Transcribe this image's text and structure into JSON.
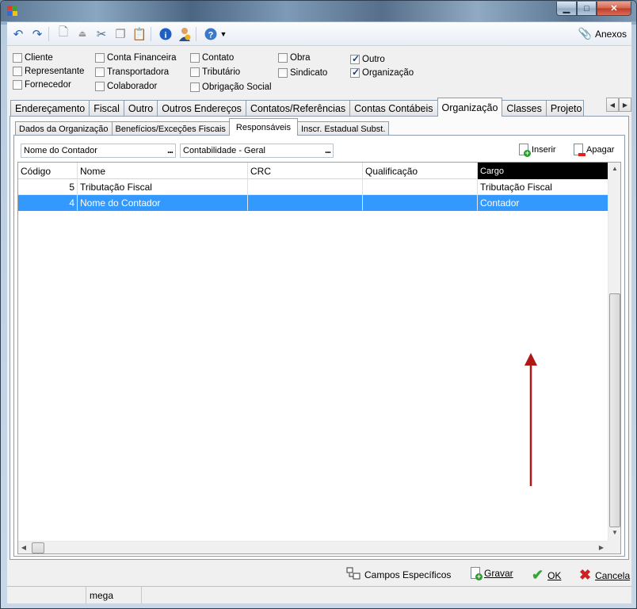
{
  "toolbar": {
    "icons": [
      "undo-icon",
      "redo-icon",
      "new-document-icon",
      "eject-icon",
      "cut-icon",
      "copy-icon",
      "paste-icon",
      "info-icon",
      "user-icon",
      "help-icon",
      "dropdown-arrow-icon"
    ],
    "anexos_label": "Anexos"
  },
  "checkboxes": [
    {
      "label": "Cliente",
      "checked": false
    },
    {
      "label": "Representante",
      "checked": false
    },
    {
      "label": "Fornecedor",
      "checked": false
    },
    {
      "label": "Conta Financeira",
      "checked": false
    },
    {
      "label": "Transportadora",
      "checked": false
    },
    {
      "label": "Colaborador",
      "checked": false
    },
    {
      "label": "Contato",
      "checked": false
    },
    {
      "label": "Tributário",
      "checked": false
    },
    {
      "label": "Obrigação Social",
      "checked": false
    },
    {
      "label": "Obra",
      "checked": false
    },
    {
      "label": "Sindicato",
      "checked": false
    },
    {
      "label": "Outro",
      "checked": true
    },
    {
      "label": "Organização",
      "checked": true
    }
  ],
  "main_tabs": [
    "Endereçamento",
    "Fiscal",
    "Outro",
    "Outros Endereços",
    "Contatos/Referências",
    "Contas Contábeis",
    "Organização",
    "Classes",
    "Projeto"
  ],
  "main_tab_active": "Organização",
  "sub_tabs": [
    "Dados da Organização",
    "Benefícios/Exceções Fiscais",
    "Responsáveis",
    "Inscr. Estadual Subst."
  ],
  "sub_tab_active": "Responsáveis",
  "filters": {
    "field1": "Nome do Contador",
    "field2": "Contabilidade - Geral",
    "dots": "..."
  },
  "actions": {
    "insert": "Inserir",
    "delete": "Apagar"
  },
  "grid": {
    "columns": [
      "Código",
      "Nome",
      "CRC",
      "Qualificação",
      "Cargo"
    ],
    "selected_column": "Cargo",
    "rows": [
      {
        "codigo": "5",
        "nome": "Tributação Fiscal",
        "crc": "",
        "qualificacao": "",
        "cargo": "Tributação Fiscal",
        "selected": false
      },
      {
        "codigo": "4",
        "nome": "Nome do Contador",
        "crc": "",
        "qualificacao": "",
        "cargo": "Contador",
        "selected": true
      }
    ]
  },
  "bottom": {
    "campos": "Campos Específicos",
    "gravar": "Gravar",
    "ok": "OK",
    "cancela": "Cancela"
  },
  "status": {
    "segment2": "mega"
  },
  "colors": {
    "selection": "#3399ff",
    "annotation_arrow": "#b01818"
  }
}
